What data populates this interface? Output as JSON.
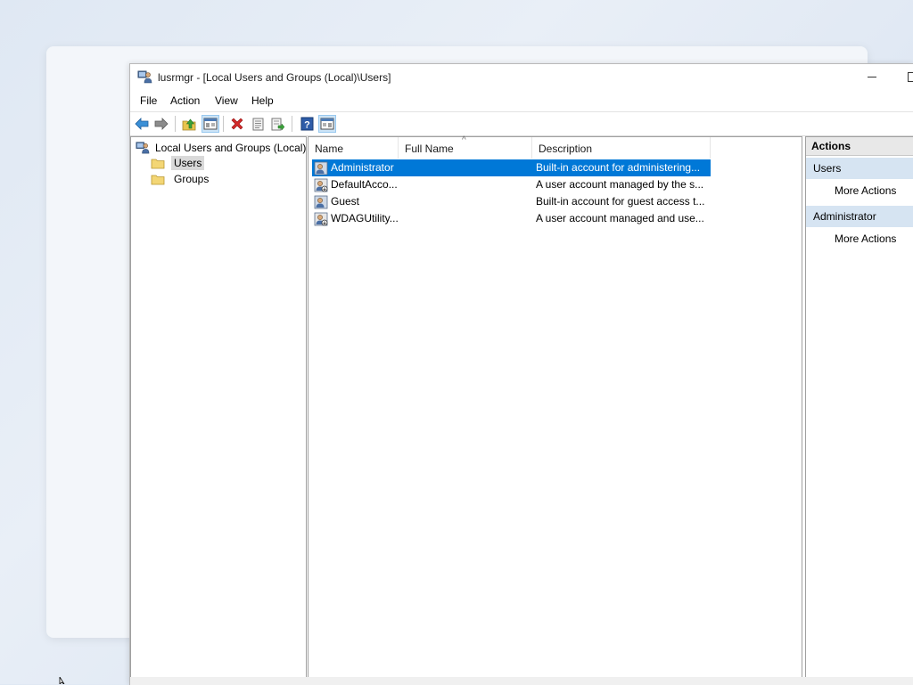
{
  "window": {
    "title": "lusrmgr - [Local Users and Groups (Local)\\Users]"
  },
  "menu": [
    "File",
    "Action",
    "View",
    "Help"
  ],
  "toolbar": {
    "buttons": [
      "back-icon",
      "forward-icon",
      "up-folder-icon",
      "show-hide-tree-icon",
      "delete-icon",
      "properties-icon",
      "export-list-icon",
      "help-icon",
      "show-hide-action-pane-icon"
    ]
  },
  "tree": {
    "root": "Local Users and Groups (Local)",
    "children": [
      "Users",
      "Groups"
    ],
    "selected": "Users"
  },
  "list": {
    "columns": [
      "Name",
      "Full Name",
      "Description"
    ],
    "sort_indicator": "^",
    "rows": [
      {
        "name": "Administrator",
        "full_name": "",
        "description": "Built-in account for administering..."
      },
      {
        "name": "DefaultAcco...",
        "full_name": "",
        "description": "A user account managed by the s..."
      },
      {
        "name": "Guest",
        "full_name": "",
        "description": "Built-in account for guest access t..."
      },
      {
        "name": "WDAGUtility...",
        "full_name": "",
        "description": "A user account managed and use..."
      }
    ],
    "selected_row": "Administrator"
  },
  "actions": {
    "title": "Actions",
    "sections": [
      {
        "header": "Users",
        "link": "More Actions"
      },
      {
        "header": "Administrator",
        "link": "More Actions"
      }
    ]
  },
  "colors": {
    "selection": "#0078d7",
    "section_bg": "#d6e4f2"
  }
}
